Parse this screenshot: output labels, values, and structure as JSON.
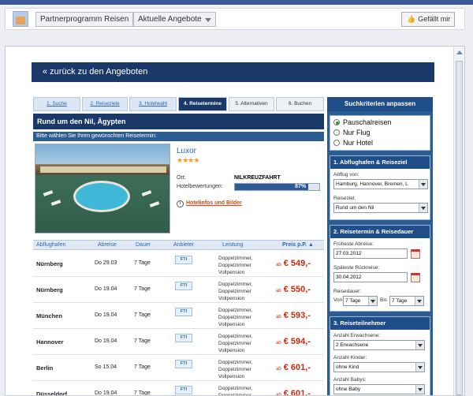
{
  "fb": {
    "tab1": "Partnerprogramm Reisen",
    "tab2": "Aktuelle Angebote",
    "like": "Gefällt mir"
  },
  "back": "« zurück zu den Angeboten",
  "steps": [
    "1. Suche",
    "2. Reiseziele",
    "3. Hotelwahl",
    "4. Reisetermine",
    "5. Alternativen",
    "6. Buchen"
  ],
  "trip_title": "Rund um den Nil, Ägypten",
  "choose_text": "Bitte wählen Sie Ihren gewünschten Reisetermin:",
  "hotel": {
    "name": "Luxor",
    "stars": "★★★★",
    "ort_label": "Ort:",
    "ort_value": "NILKREUZFAHRT",
    "rating_label": "Hotelbewertungen:",
    "rating": "87%",
    "rating_value": 87,
    "info_link": "Hotelinfos und Bilder",
    "info_icon": "i"
  },
  "table": {
    "headers": [
      "Abflughafen",
      "Abreise",
      "Dauer",
      "Anbieter",
      "Leistung",
      "Preis p.P."
    ],
    "sort_icon": "▲",
    "rows": [
      {
        "city": "Nürnberg",
        "date": "Do 29.03",
        "dur": "7 Tage",
        "logo": "FTI",
        "serv1": "Doppelzimmer,",
        "serv2": "Doppelzimmer",
        "serv3": "Vollpension",
        "ab": "ab",
        "price": "€ 549,-"
      },
      {
        "city": "Nürnberg",
        "date": "Do 19.04",
        "dur": "7 Tage",
        "logo": "FTI",
        "serv1": "Doppelzimmer,",
        "serv2": "Doppelzimmer",
        "serv3": "Vollpension",
        "ab": "ab",
        "price": "€ 550,-"
      },
      {
        "city": "München",
        "date": "Do 19.04",
        "dur": "7 Tage",
        "logo": "FTI",
        "serv1": "Doppelzimmer,",
        "serv2": "Doppelzimmer",
        "serv3": "Vollpension",
        "ab": "ab",
        "price": "€ 593,-"
      },
      {
        "city": "Hannover",
        "date": "Do 19.04",
        "dur": "7 Tage",
        "logo": "FTI",
        "serv1": "Doppelzimmer,",
        "serv2": "Doppelzimmer",
        "serv3": "Vollpension",
        "ab": "ab",
        "price": "€ 594,-"
      },
      {
        "city": "Berlin",
        "date": "So 15.04",
        "dur": "7 Tage",
        "logo": "FTI",
        "serv1": "Doppelzimmer,",
        "serv2": "Doppelzimmer",
        "serv3": "Vollpension",
        "ab": "ab",
        "price": "€ 601,-"
      },
      {
        "city": "Düsseldorf",
        "date": "Do 19.04",
        "dur": "7 Tage",
        "logo": "FTI",
        "serv1": "Doppelzimmer,",
        "serv2": "Doppelzimmer",
        "serv3": "Vollpension",
        "ab": "ab",
        "price": "€ 601,-"
      }
    ]
  },
  "side": {
    "title": "Suchkriterien anpassen",
    "radios": [
      "Pauschalreisen",
      "Nur Flug",
      "Nur Hotel"
    ],
    "s1": {
      "title": "1. Abflughafen & Reiseziel",
      "l1": "Abflug von:",
      "v1": "Hamburg, Hannover, Bremen, L",
      "l2": "Reiseziel:",
      "v2": "Rund um den Nil"
    },
    "s2": {
      "title": "2. Reisetermin & Reisedauer",
      "l1": "Früheste Abreise:",
      "v1": "27.03.2012",
      "l2": "Späteste Rückreise:",
      "v2": "30.04.2012",
      "l3": "Reisedauer:",
      "von": "Von",
      "v3": "7 Tage",
      "bis": "Bis",
      "v4": "7 Tage"
    },
    "s3": {
      "title": "3. Reiseteilnehmer",
      "l1": "Anzahl Erwachsene:",
      "v1": "2 Erwachsene",
      "l2": "Anzahl Kinder:",
      "v2": "ohne Kind",
      "l3": "Anzahl Babys:",
      "v3": "ohne Baby"
    }
  }
}
